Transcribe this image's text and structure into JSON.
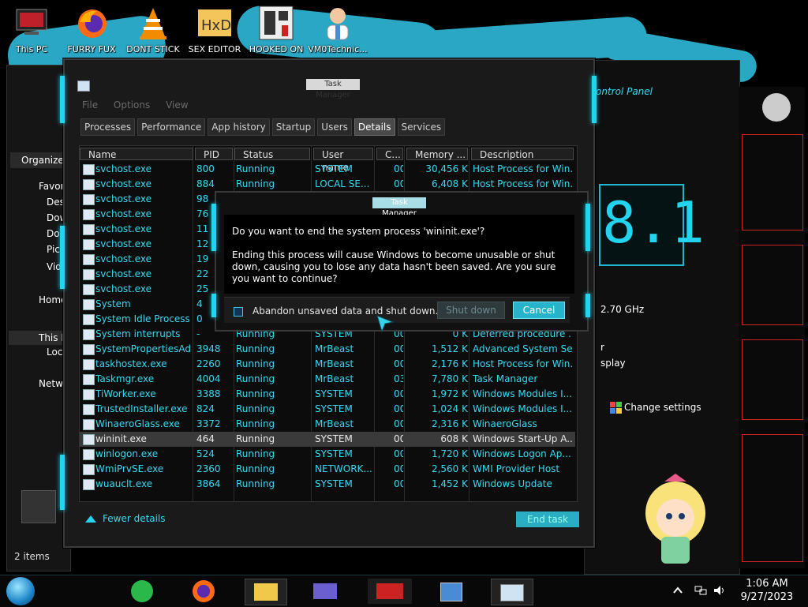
{
  "desktop_icons": [
    {
      "label": "This PC",
      "icon": "computer-icon"
    },
    {
      "label": "FURRY FUX",
      "icon": "firefox-icon"
    },
    {
      "label": "DONT STICK",
      "icon": "vlc-icon"
    },
    {
      "label": "SEX EDITOR",
      "icon": "hxd-editor-icon"
    },
    {
      "label": "HOOKED ON",
      "icon": "game-icon"
    },
    {
      "label": "VM0Technic...",
      "icon": "doctor-icon"
    }
  ],
  "explorer": {
    "organize": "Organize",
    "nav": [
      "Favor",
      "Des",
      "Dow",
      "Doc",
      "Pict",
      "Vide",
      "Home",
      "This P",
      "Loc",
      "Netwo"
    ],
    "status": "2 items"
  },
  "control_panel": {
    "address": "ontrol Panel",
    "version": "8.1",
    "cpu": "2.70 GHz",
    "line1": "r",
    "line2": "splay",
    "change_settings": "Change settings"
  },
  "task_manager": {
    "title": "Task Manager",
    "menu": [
      "File",
      "Options",
      "View"
    ],
    "tabs": [
      "Processes",
      "Performance",
      "App history",
      "Startup",
      "Users",
      "Details",
      "Services"
    ],
    "active_tab": "Details",
    "columns": [
      "Name",
      "PID",
      "Status",
      "User name",
      "C...",
      "Memory ...",
      "Description"
    ],
    "rows": [
      [
        "svchost.exe",
        "800",
        "Running",
        "SYSTEM",
        "00",
        "30,456 K",
        "Host Process for Win..."
      ],
      [
        "svchost.exe",
        "884",
        "Running",
        "LOCAL SE...",
        "00",
        "6,408 K",
        "Host Process for Win..."
      ],
      [
        "svchost.exe",
        "98",
        "",
        "",
        "",
        "",
        ""
      ],
      [
        "svchost.exe",
        "76",
        "",
        "",
        "",
        "",
        ""
      ],
      [
        "svchost.exe",
        "11",
        "",
        "",
        "",
        "",
        ""
      ],
      [
        "svchost.exe",
        "12",
        "",
        "",
        "",
        "",
        ""
      ],
      [
        "svchost.exe",
        "19",
        "",
        "",
        "",
        "",
        ""
      ],
      [
        "svchost.exe",
        "22",
        "",
        "",
        "",
        "",
        ""
      ],
      [
        "svchost.exe",
        "25",
        "",
        "",
        "",
        "",
        ""
      ],
      [
        "System",
        "4",
        "",
        "",
        "",
        "",
        ""
      ],
      [
        "System Idle Process",
        "0",
        "",
        "",
        "",
        "",
        ""
      ],
      [
        "System interrupts",
        "-",
        "Running",
        "SYSTEM",
        "00",
        "0 K",
        "Deferred procedure ..."
      ],
      [
        "SystemPropertiesAd...",
        "3948",
        "Running",
        "MrBeast",
        "00",
        "1,512 K",
        "Advanced System Se..."
      ],
      [
        "taskhostex.exe",
        "2260",
        "Running",
        "MrBeast",
        "00",
        "2,176 K",
        "Host Process for Win..."
      ],
      [
        "Taskmgr.exe",
        "4004",
        "Running",
        "MrBeast",
        "03",
        "7,780 K",
        "Task Manager"
      ],
      [
        "TiWorker.exe",
        "3388",
        "Running",
        "SYSTEM",
        "00",
        "1,972 K",
        "Windows Modules I..."
      ],
      [
        "TrustedInstaller.exe",
        "824",
        "Running",
        "SYSTEM",
        "00",
        "1,024 K",
        "Windows Modules I..."
      ],
      [
        "WinaeroGlass.exe",
        "3372",
        "Running",
        "MrBeast",
        "00",
        "2,316 K",
        "WinaeroGlass"
      ],
      [
        "wininit.exe",
        "464",
        "Running",
        "SYSTEM",
        "00",
        "608 K",
        "Windows Start-Up A..."
      ],
      [
        "winlogon.exe",
        "524",
        "Running",
        "SYSTEM",
        "00",
        "1,720 K",
        "Windows Logon Ap..."
      ],
      [
        "WmiPrvSE.exe",
        "2360",
        "Running",
        "NETWORK...",
        "00",
        "2,560 K",
        "WMI Provider Host"
      ],
      [
        "wuauclt.exe",
        "3864",
        "Running",
        "SYSTEM",
        "00",
        "1,452 K",
        "Windows Update"
      ]
    ],
    "selected_row": 18,
    "fewer_details": "Fewer details",
    "end_task": "End task"
  },
  "dialog": {
    "title": "Task Manager",
    "question": "Do you want to end the system process 'wininit.exe'?",
    "message": "Ending this process will cause Windows to become unusable or shut down, causing you to lose any data hasn't been saved. Are you sure you want to continue?",
    "checkbox": "Abandon unsaved data and shut down.",
    "shutdown": "Shut down",
    "cancel": "Cancel"
  },
  "taskbar": {
    "time": "1:06 AM",
    "date": "9/27/2023"
  },
  "colors": {
    "accent": "#22d4ee",
    "text_cyan": "#39d9f0",
    "panel": "#1a1a1a"
  }
}
